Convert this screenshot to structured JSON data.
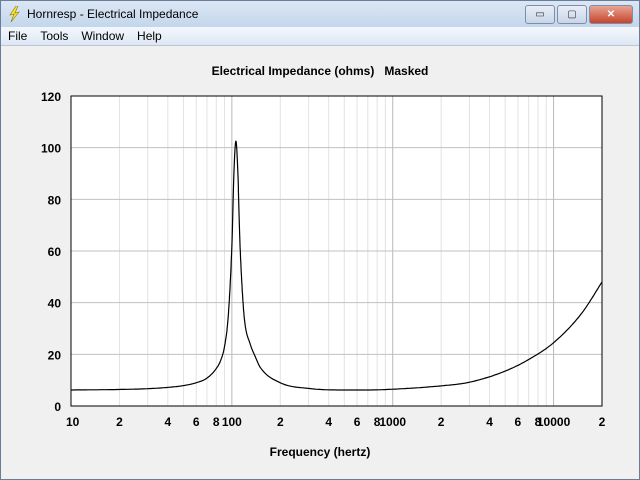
{
  "window": {
    "title": "Hornresp - Electrical Impedance",
    "buttons": {
      "minimize": "▭",
      "maximize": "▢",
      "close": "✕"
    }
  },
  "menu": [
    "File",
    "Tools",
    "Window",
    "Help"
  ],
  "chart_data": {
    "type": "line",
    "title": "Electrical Impedance (ohms)   Masked",
    "xlabel": "Frequency (hertz)",
    "ylabel": "",
    "xscale": "log",
    "xlim": [
      10,
      20000
    ],
    "ylim": [
      0,
      120
    ],
    "grid": true,
    "yticks": [
      0,
      20,
      40,
      60,
      80,
      100,
      120
    ],
    "xticks": [
      {
        "v": 10,
        "label": "10"
      },
      {
        "v": 20,
        "label": "2"
      },
      {
        "v": 40,
        "label": "4"
      },
      {
        "v": 60,
        "label": "6"
      },
      {
        "v": 80,
        "label": "8"
      },
      {
        "v": 100,
        "label": "100"
      },
      {
        "v": 200,
        "label": "2"
      },
      {
        "v": 400,
        "label": "4"
      },
      {
        "v": 600,
        "label": "6"
      },
      {
        "v": 800,
        "label": "8"
      },
      {
        "v": 1000,
        "label": "1000"
      },
      {
        "v": 2000,
        "label": "2"
      },
      {
        "v": 4000,
        "label": "4"
      },
      {
        "v": 6000,
        "label": "6"
      },
      {
        "v": 8000,
        "label": "8"
      },
      {
        "v": 10000,
        "label": "10000"
      },
      {
        "v": 20000,
        "label": "2"
      }
    ],
    "series": [
      {
        "name": "Impedance",
        "color": "#000000",
        "x": [
          10,
          20,
          30,
          40,
          50,
          60,
          70,
          80,
          85,
          90,
          95,
          100,
          103,
          106,
          109,
          112,
          116,
          120,
          130,
          140,
          150,
          200,
          300,
          500,
          700,
          1000,
          2000,
          3000,
          5000,
          7000,
          10000,
          15000,
          20000
        ],
        "y": [
          6.2,
          6.4,
          6.7,
          7.2,
          7.9,
          9.0,
          10.8,
          14.5,
          17.5,
          23,
          35,
          62,
          90,
          102.5,
          90,
          65,
          45,
          33,
          24,
          19,
          15,
          9,
          6.8,
          6.2,
          6.2,
          6.5,
          7.8,
          9.2,
          13.5,
          18,
          24.5,
          36,
          48
        ]
      }
    ]
  }
}
